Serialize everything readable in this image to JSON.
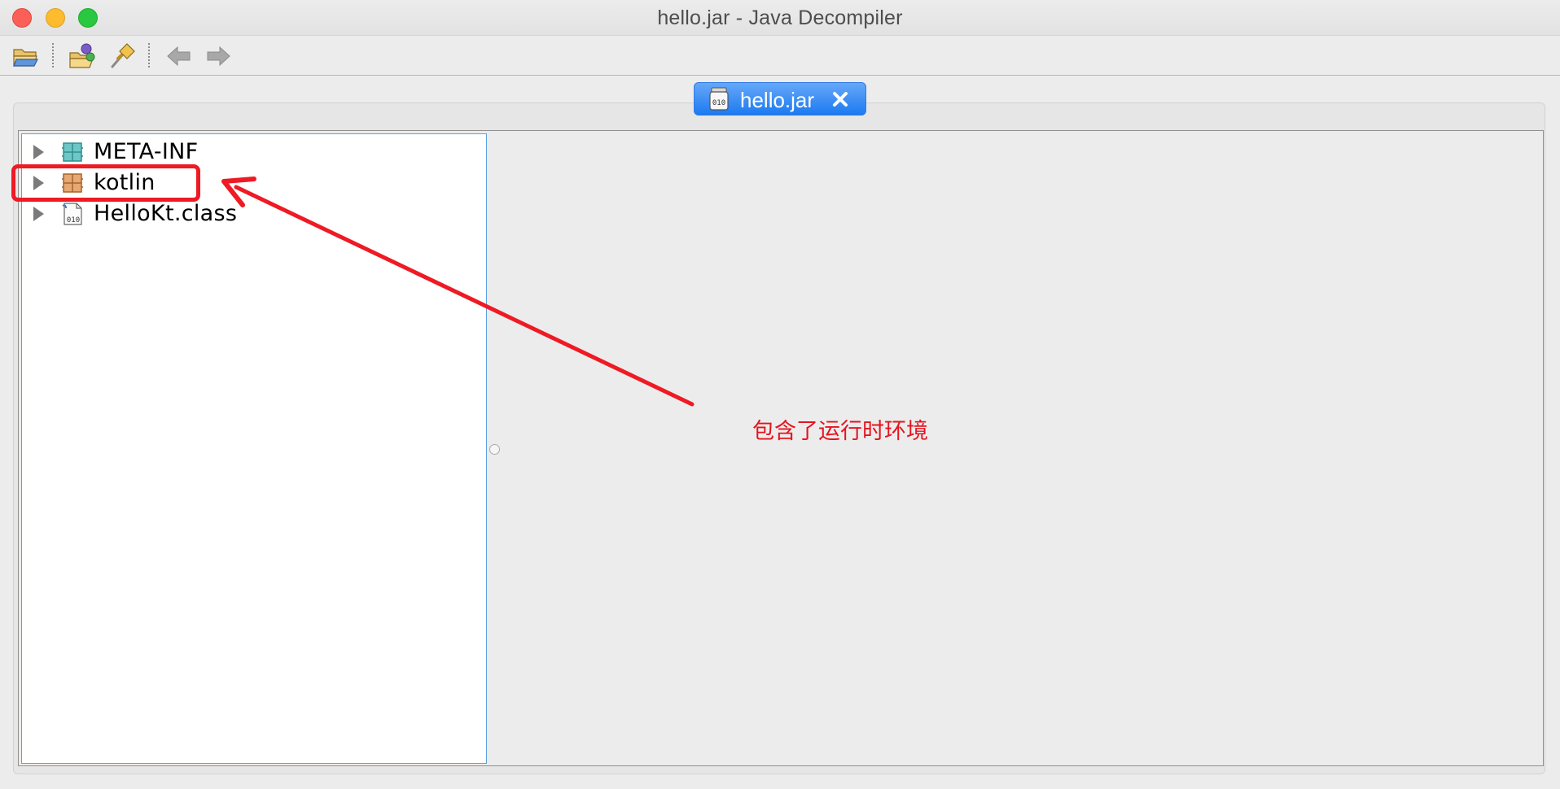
{
  "window": {
    "title": "hello.jar - Java Decompiler"
  },
  "toolbar": {
    "buttons": [
      {
        "icon": "open-file-icon"
      },
      {
        "icon": "open-type-icon"
      },
      {
        "icon": "search-icon"
      },
      {
        "icon": "back-arrow-icon"
      },
      {
        "icon": "forward-arrow-icon"
      }
    ]
  },
  "tabs": [
    {
      "label": "hello.jar",
      "icon": "jar-file-icon",
      "active": true
    }
  ],
  "tree": {
    "items": [
      {
        "label": "META-INF",
        "icon": "package-icon"
      },
      {
        "label": "kotlin",
        "icon": "package-icon"
      },
      {
        "label": "HelloKt.class",
        "icon": "class-file-icon"
      }
    ]
  },
  "annotation": {
    "note": "包含了运行时环境",
    "color": "#e4141e"
  },
  "colors": {
    "tab_active": "#1c7af0",
    "tree_border": "#5ea1e2"
  }
}
